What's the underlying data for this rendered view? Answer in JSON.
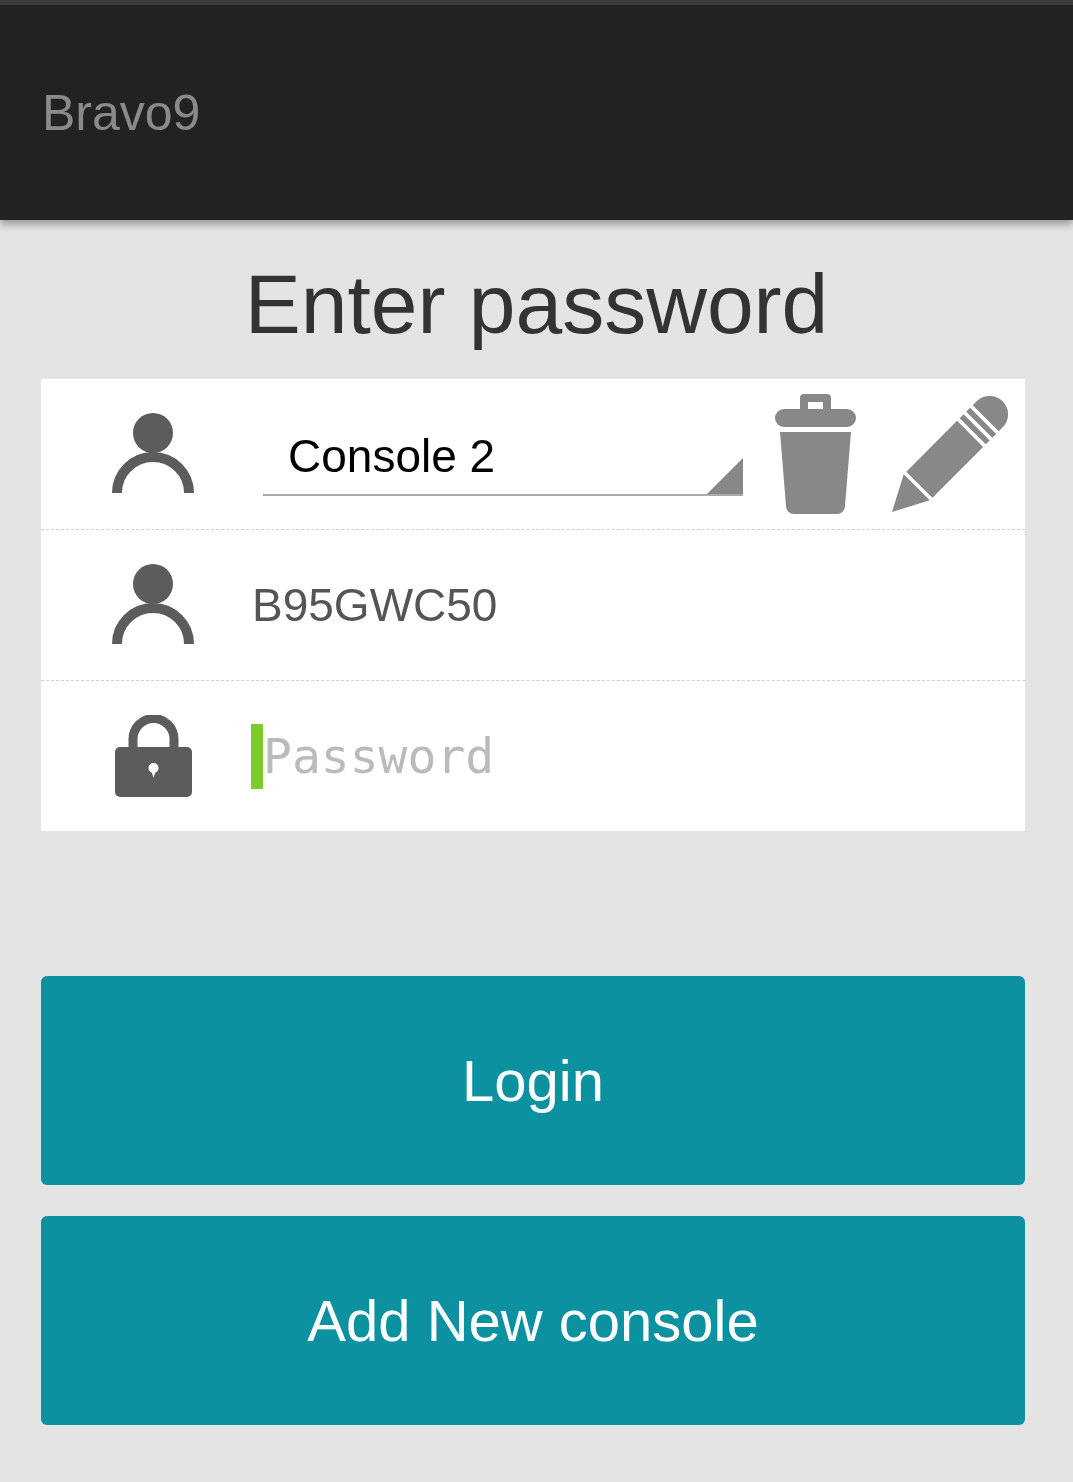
{
  "app_bar": {
    "title": "Bravo9"
  },
  "heading": "Enter password",
  "console_select": {
    "value": "Console 2"
  },
  "username": {
    "value": "B95GWC50"
  },
  "password": {
    "placeholder": "Password",
    "focused": true
  },
  "buttons": [
    {
      "label": "Login"
    },
    {
      "label": "Add New console"
    }
  ]
}
